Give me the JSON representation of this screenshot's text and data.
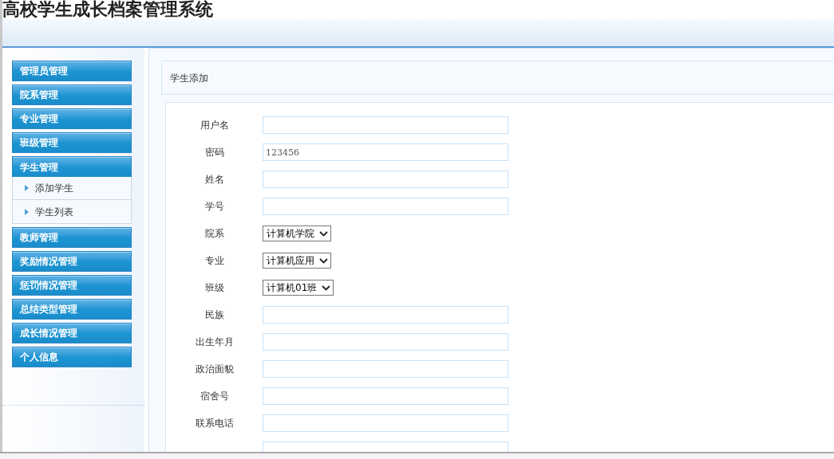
{
  "app_title": "高校学生成长档案管理系统",
  "sidebar": {
    "items": [
      {
        "label": "管理员管理",
        "expanded": false
      },
      {
        "label": "院系管理",
        "expanded": false
      },
      {
        "label": "专业管理",
        "expanded": false
      },
      {
        "label": "班级管理",
        "expanded": false
      },
      {
        "label": "学生管理",
        "expanded": true,
        "children": [
          {
            "label": "添加学生"
          },
          {
            "label": "学生列表"
          }
        ]
      },
      {
        "label": "教师管理",
        "expanded": false
      },
      {
        "label": "奖励情况管理",
        "expanded": false
      },
      {
        "label": "惩罚情况管理",
        "expanded": false
      },
      {
        "label": "总结类型管理",
        "expanded": false
      },
      {
        "label": "成长情况管理",
        "expanded": false
      },
      {
        "label": "个人信息",
        "expanded": false
      }
    ]
  },
  "panel_title": "学生添加",
  "form": {
    "fields": [
      {
        "kind": "text",
        "label": "用户名"
      },
      {
        "kind": "text",
        "label": "密码",
        "value": "123456"
      },
      {
        "kind": "text",
        "label": "姓名"
      },
      {
        "kind": "text",
        "label": "学号"
      },
      {
        "kind": "select",
        "label": "院系",
        "value": "计算机学院"
      },
      {
        "kind": "select",
        "label": "专业",
        "value": "计算机应用"
      },
      {
        "kind": "select",
        "label": "班级",
        "value": "计算机01班"
      },
      {
        "kind": "text",
        "label": "民族"
      },
      {
        "kind": "text",
        "label": "出生年月"
      },
      {
        "kind": "text",
        "label": "政治面貌"
      },
      {
        "kind": "text",
        "label": "宿舍号"
      },
      {
        "kind": "text",
        "label": "联系电话"
      },
      {
        "kind": "text"
      }
    ]
  }
}
